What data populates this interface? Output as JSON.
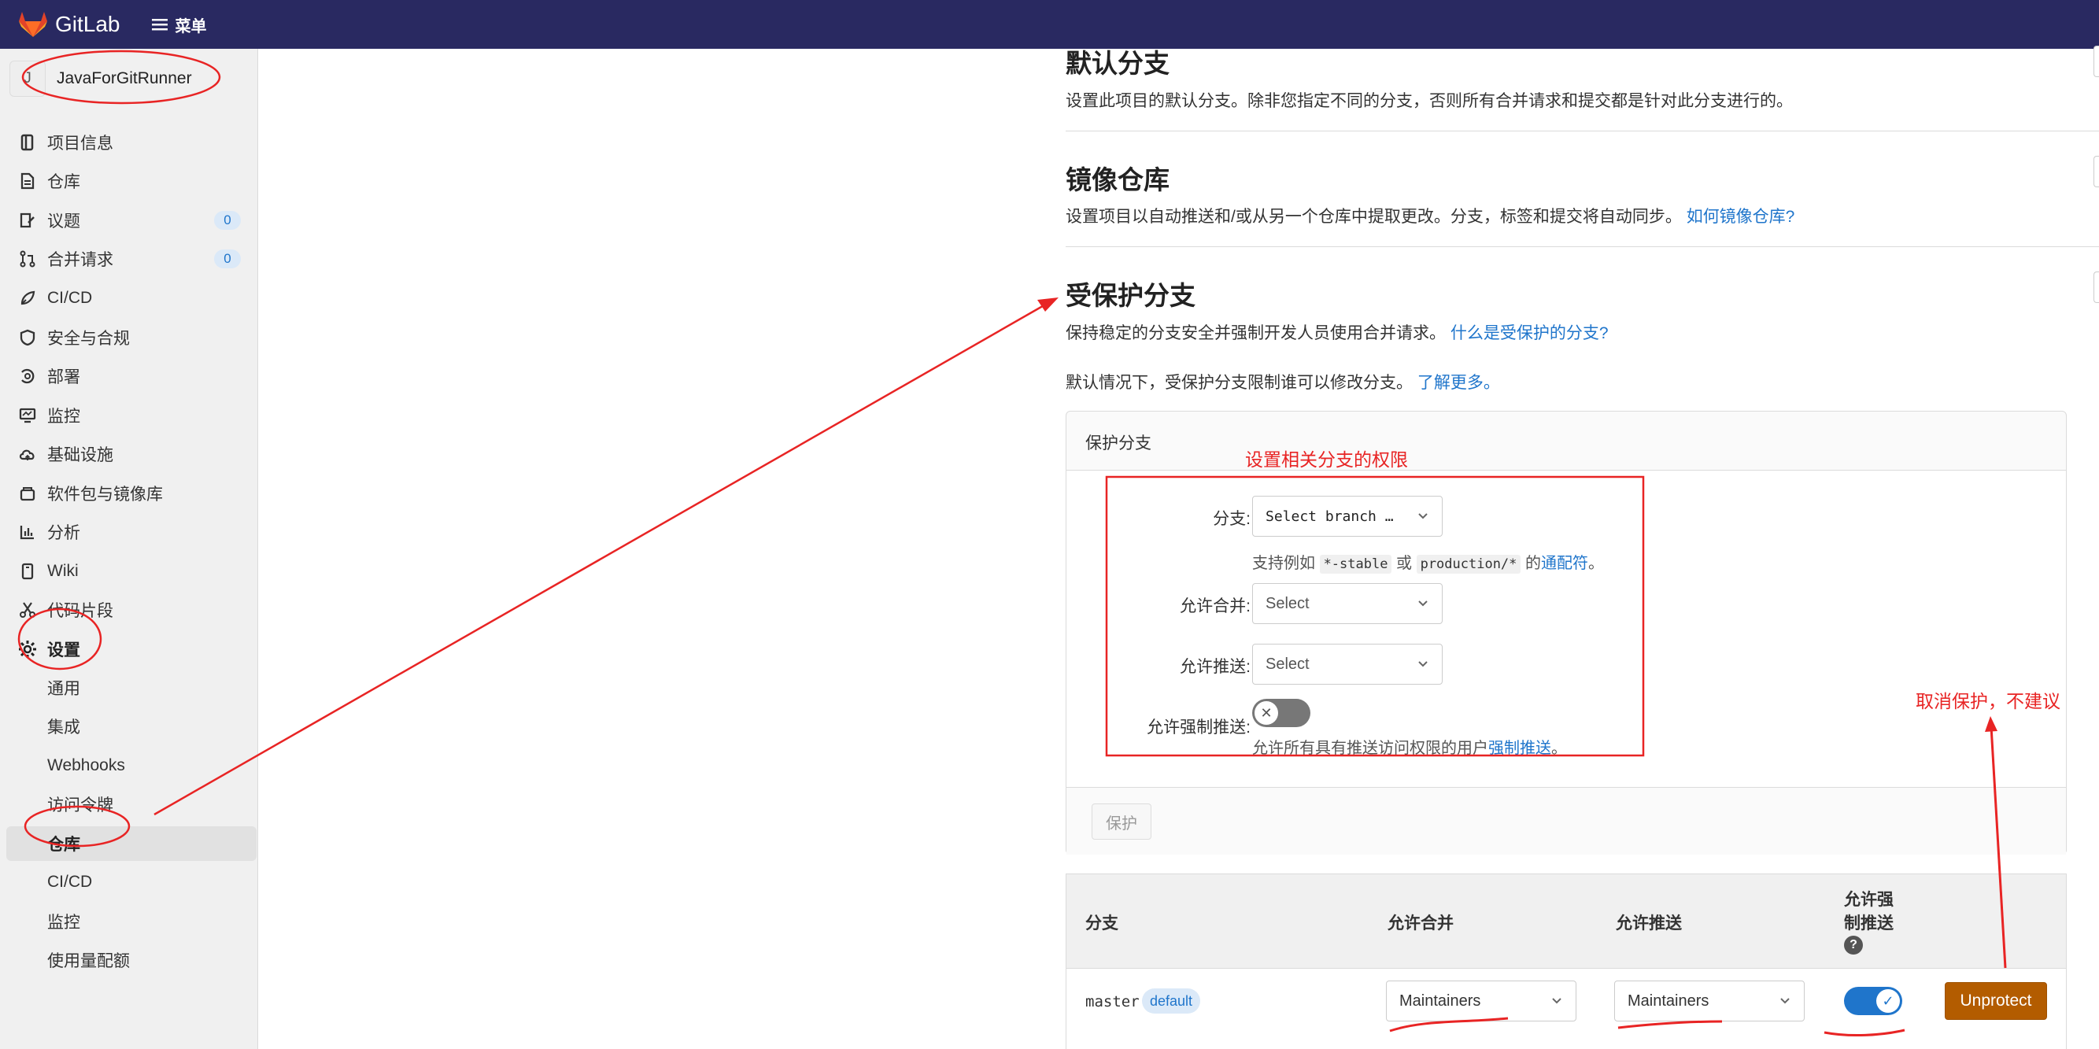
{
  "topbar": {
    "app_name": "GitLab",
    "menu_label": "菜单"
  },
  "sidebar": {
    "project_avatar": "J",
    "project_name": "JavaForGitRunner",
    "items": [
      {
        "label": "项目信息",
        "icon": "book-icon"
      },
      {
        "label": "仓库",
        "icon": "document-icon"
      },
      {
        "label": "议题",
        "icon": "issues-icon",
        "badge": "0"
      },
      {
        "label": "合并请求",
        "icon": "merge-request-icon",
        "badge": "0"
      },
      {
        "label": "CI/CD",
        "icon": "rocket-icon"
      },
      {
        "label": "安全与合规",
        "icon": "shield-icon"
      },
      {
        "label": "部署",
        "icon": "deploy-icon"
      },
      {
        "label": "监控",
        "icon": "monitor-icon"
      },
      {
        "label": "基础设施",
        "icon": "cloud-icon"
      },
      {
        "label": "软件包与镜像库",
        "icon": "package-icon"
      },
      {
        "label": "分析",
        "icon": "chart-icon"
      },
      {
        "label": "Wiki",
        "icon": "wiki-icon"
      },
      {
        "label": "代码片段",
        "icon": "scissors-icon"
      },
      {
        "label": "设置",
        "icon": "gear-icon"
      }
    ],
    "settings_sub": [
      "通用",
      "集成",
      "Webhooks",
      "访问令牌",
      "仓库",
      "CI/CD",
      "监控",
      "使用量配额"
    ]
  },
  "main": {
    "default_branch": {
      "title": "默认分支",
      "desc": "设置此项目的默认分支。除非您指定不同的分支，否则所有合并请求和提交都是针对此分支进行的。"
    },
    "mirror": {
      "title": "镜像仓库",
      "desc": "设置项目以自动推送和/或从另一个仓库中提取更改。分支，标签和提交将自动同步。",
      "link": "如何镜像仓库?"
    },
    "protected": {
      "title": "受保护分支",
      "desc": "保持稳定的分支安全并强制开发人员使用合并请求。",
      "desc_link": "什么是受保护的分支?",
      "desc2": "默认情况下，受保护分支限制谁可以修改分支。",
      "desc2_link": "了解更多。"
    },
    "form": {
      "card_title": "保护分支",
      "branch_label": "分支:",
      "branch_value": "Select branch …",
      "branch_hint_pre": "支持例如",
      "branch_hint_code1": "*-stable",
      "branch_hint_or": "或",
      "branch_hint_code2": "production/*",
      "branch_hint_de": "的",
      "branch_hint_link": "通配符",
      "branch_hint_end": "。",
      "merge_label": "允许合并:",
      "merge_value": "Select",
      "push_label": "允许推送:",
      "push_value": "Select",
      "force_label": "允许强制推送:",
      "force_hint_pre": "允许所有具有推送访问权限的用户",
      "force_hint_link": "强制推送",
      "force_hint_end": "。",
      "protect_button": "保护"
    },
    "table": {
      "col_branch": "分支",
      "col_merge": "允许合并",
      "col_push": "允许推送",
      "col_force_line1": "允许强",
      "col_force_line2": "制推送",
      "row": {
        "branch": "master",
        "badge": "default",
        "merge": "Maintainers",
        "push": "Maintainers",
        "force_enabled": true,
        "action": "Unprotect"
      }
    }
  },
  "annotations": {
    "form_note": "设置相关分支的权限",
    "unprotect_note": "取消保护，不建议",
    "color": "#e82424"
  }
}
